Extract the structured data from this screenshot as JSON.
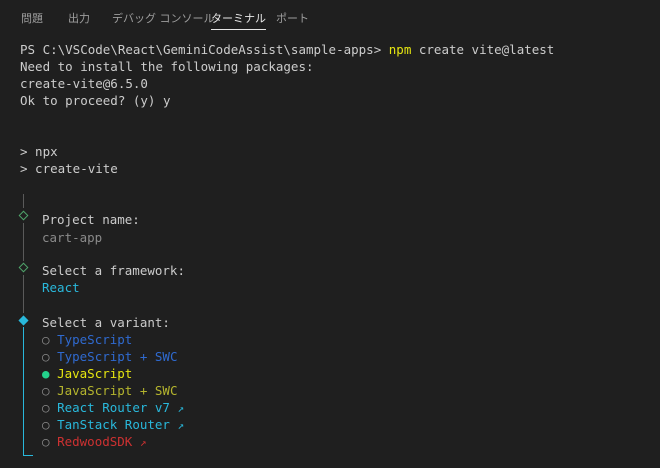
{
  "tabs": [
    {
      "label": "問題",
      "active": false
    },
    {
      "label": "出力",
      "active": false
    },
    {
      "label": "デバッグ コンソール",
      "active": false
    },
    {
      "label": "ターミナル",
      "active": true
    },
    {
      "label": "ポート",
      "active": false
    }
  ],
  "terminal": {
    "prompt": "PS C:\\VSCode\\React\\GeminiCodeAssist\\sample-apps> ",
    "command_npm": "npm",
    "command_rest": " create vite@latest",
    "install_msg": "Need to install the following packages:",
    "package": "create-vite@6.5.0",
    "proceed": "Ok to proceed? (y) y",
    "npx_line": "> npx",
    "create_vite_line": "> create-vite",
    "project_label": "Project name:",
    "project_value": "cart-app",
    "framework_label": "Select a framework:",
    "framework_value": "React",
    "variant_label": "Select a variant:",
    "variants": [
      {
        "marker": "○",
        "label": "TypeScript",
        "arrow": ""
      },
      {
        "marker": "○",
        "label": "TypeScript + SWC",
        "arrow": ""
      },
      {
        "marker": "●",
        "label": "JavaScript",
        "arrow": "",
        "selected": true
      },
      {
        "marker": "○",
        "label": "JavaScript + SWC",
        "arrow": ""
      },
      {
        "marker": "○",
        "label": "React Router v7",
        "arrow": "↗"
      },
      {
        "marker": "○",
        "label": "TanStack Router",
        "arrow": "↗"
      },
      {
        "marker": "○",
        "label": "RedwoodSDK",
        "arrow": "↗"
      }
    ]
  },
  "colors": {
    "background": "#1f1f1f",
    "accent_cyan": "#29b8db",
    "selected_yellow": "#e5e510"
  }
}
